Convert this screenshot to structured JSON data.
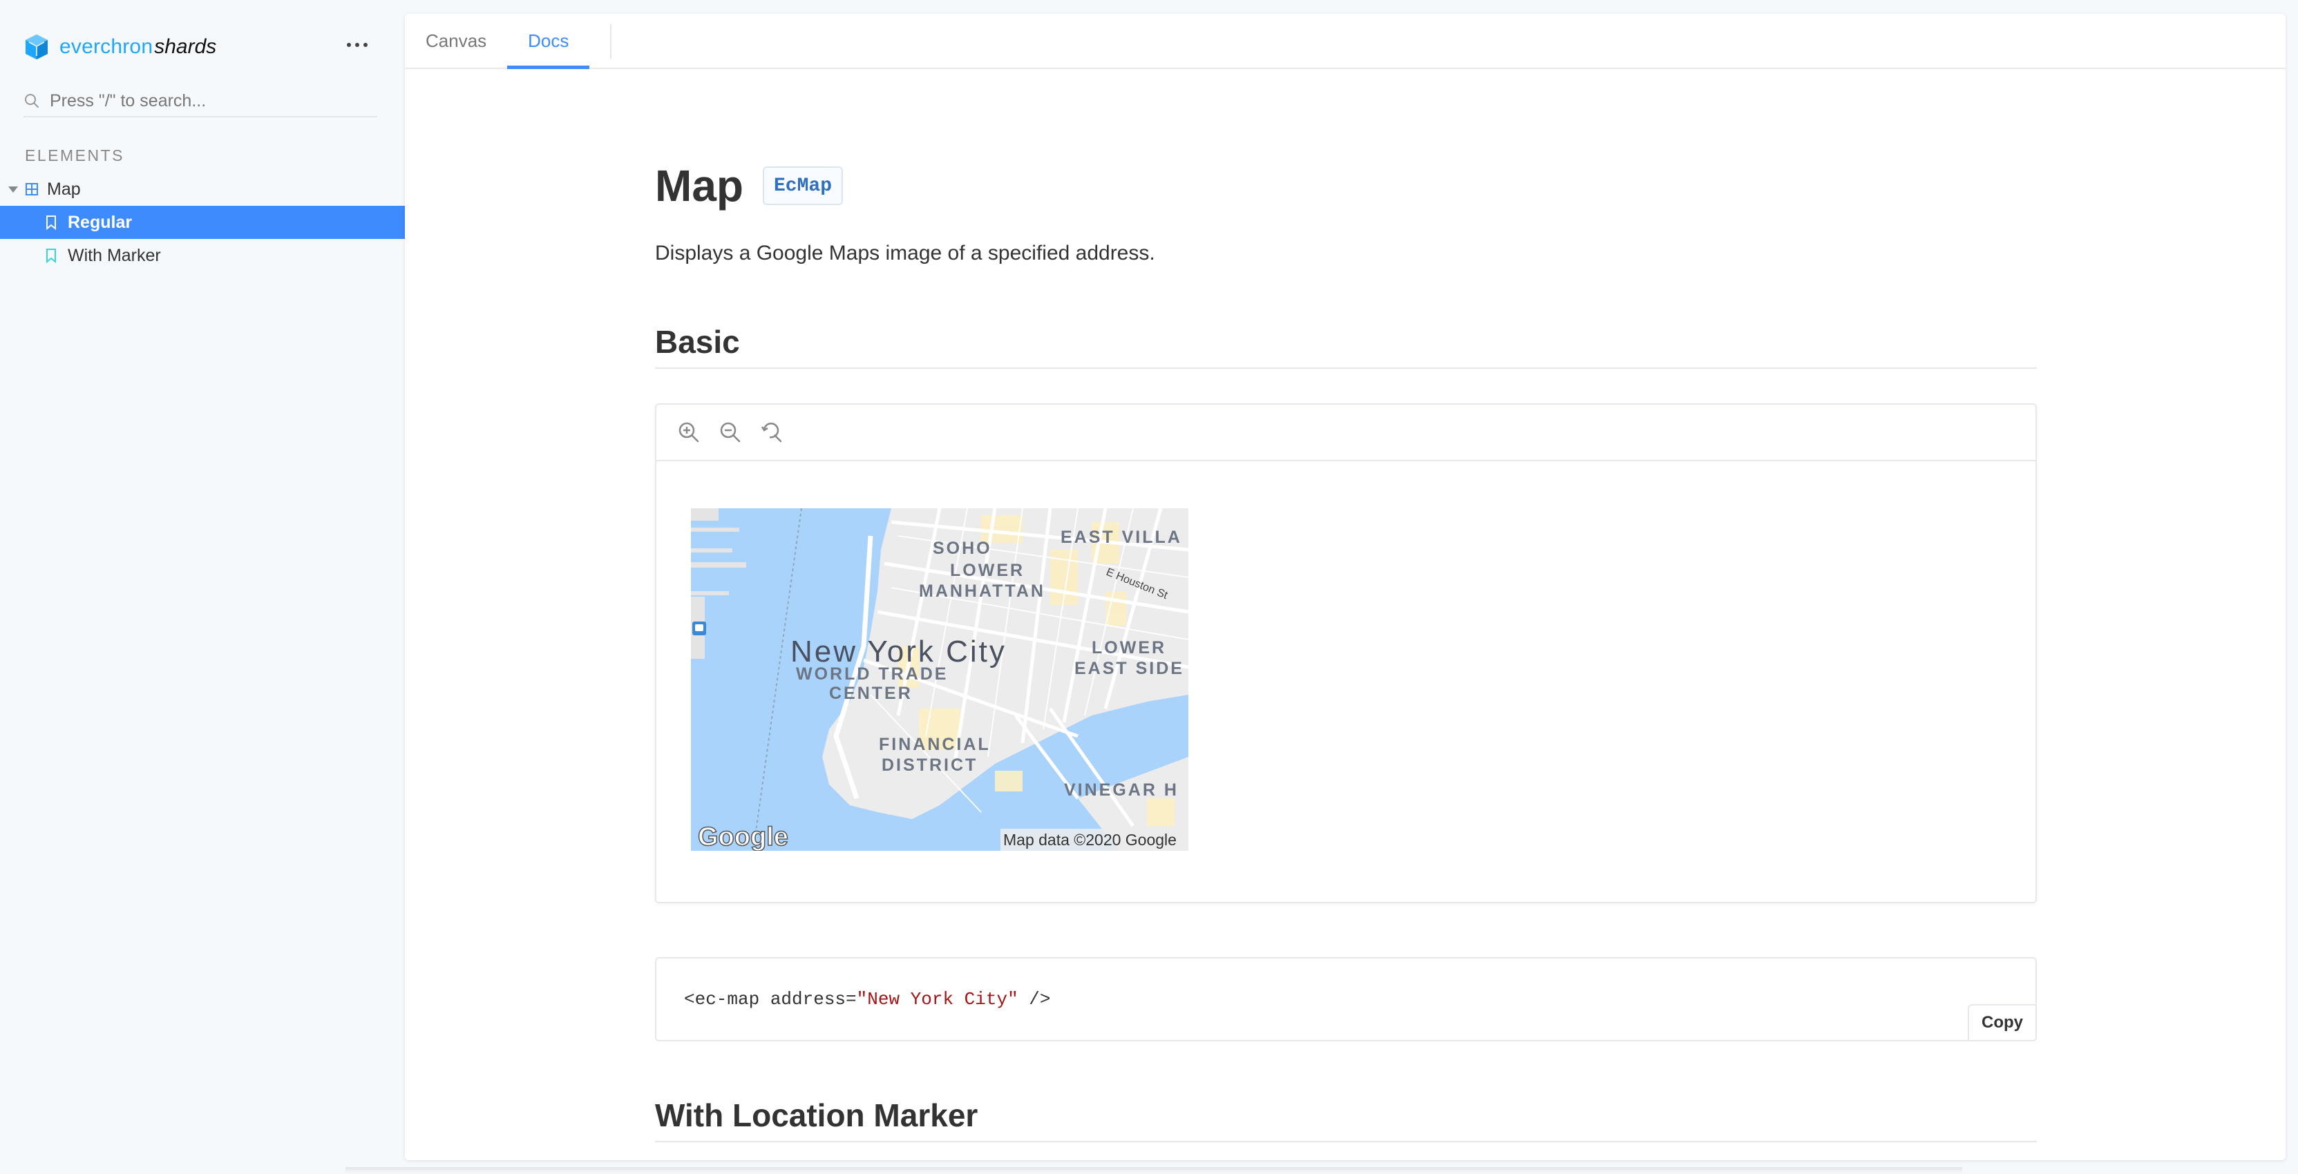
{
  "sidebar": {
    "brand_name": "everchron",
    "brand_name_em": "shards",
    "search_placeholder": "Press \"/\" to search...",
    "section_label": "ELEMENTS",
    "tree": {
      "component": "Map",
      "stories": [
        "Regular",
        "With Marker"
      ],
      "selected_story": "Regular"
    }
  },
  "tabs": [
    "Canvas",
    "Docs"
  ],
  "active_tab": "Docs",
  "doc": {
    "title": "Map",
    "component_badge": "EcMap",
    "description": "Displays a Google Maps image of a specified address.",
    "section_basic": "Basic",
    "section_marker": "With Location Marker",
    "code_tag_open": "<ec-map address=",
    "code_string": "\"New York City\"",
    "code_tag_close": " />",
    "copy_label": "Copy"
  },
  "map": {
    "labels": {
      "city": "New York City",
      "soho": "SOHO",
      "lower_manhattan_1": "LOWER",
      "lower_manhattan_2": "MANHATTAN",
      "east_village": "EAST VILLA",
      "houston": "E Houston St",
      "wtc_1": "WORLD TRADE",
      "wtc_2": "CENTER",
      "les_1": "LOWER",
      "les_2": "EAST SIDE",
      "fin_1": "FINANCIAL",
      "fin_2": "DISTRICT",
      "vinegar": "VINEGAR H",
      "google_logo": "Google",
      "attribution": "Map data ©2020 Google"
    },
    "colors": {
      "water": "#aad3fb",
      "land": "#ececec",
      "road": "#ffffff",
      "park": "#fcefc3"
    }
  },
  "colors": {
    "accent": "#3d8bfd",
    "brand": "#1ea7fd"
  }
}
